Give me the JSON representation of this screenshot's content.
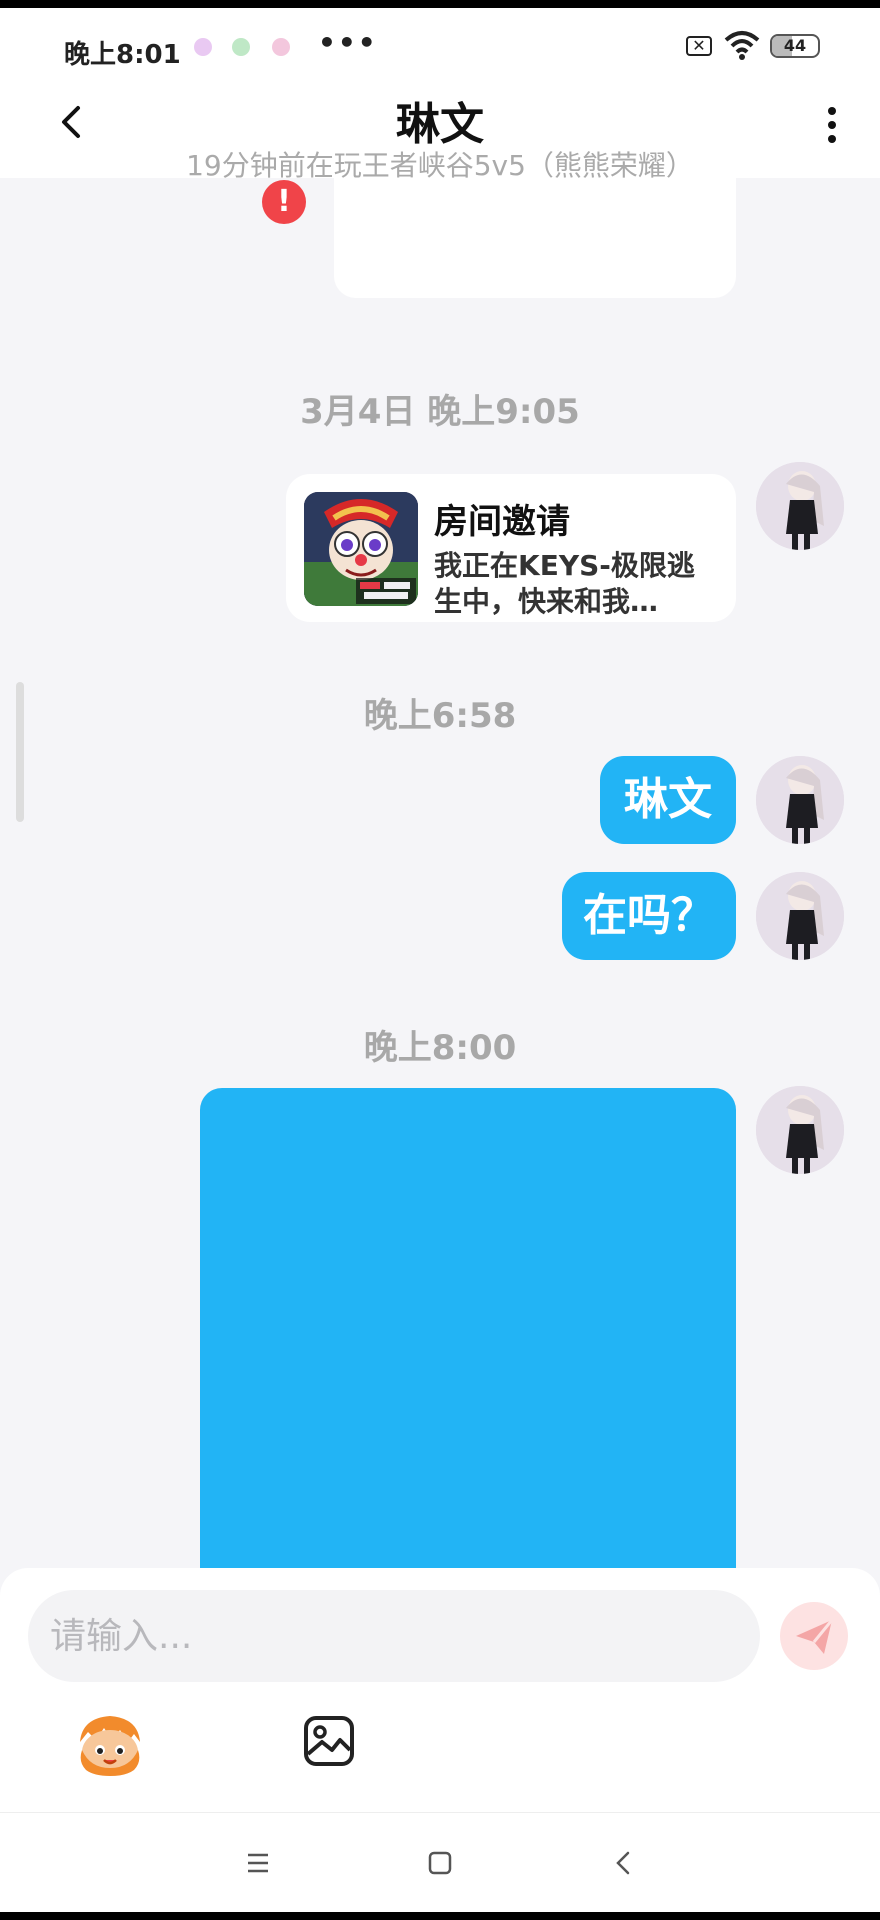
{
  "status_bar": {
    "time": "晚上8:01",
    "more": "•••",
    "sim_icon": "✕",
    "battery": "44",
    "battery_level": 0.44
  },
  "header": {
    "title": "琳文",
    "subtitle": "19分钟前在玩王者峡谷5v5（熊熊荣耀）"
  },
  "messages": {
    "error_badge": "!",
    "time_1": "3月4日 晚上9:05",
    "invite": {
      "title": "房间邀请",
      "description": "我正在KEYS-极限逃生中，快来和我…"
    },
    "time_2": "晚上6:58",
    "msg_1": "琳文",
    "msg_2": "在吗？",
    "time_3": "晚上8:00"
  },
  "input": {
    "placeholder": "请输入..."
  },
  "colors": {
    "bubble_blue": "#22b4f5",
    "error_red": "#f04449",
    "send_disabled": "#fde2e2"
  },
  "icons": [
    "back-arrow-icon",
    "more-vertical-icon",
    "wifi-icon",
    "battery-icon",
    "send-icon",
    "emoji-mascot-icon",
    "image-icon",
    "menu-icon",
    "home-icon",
    "back-nav-icon"
  ]
}
